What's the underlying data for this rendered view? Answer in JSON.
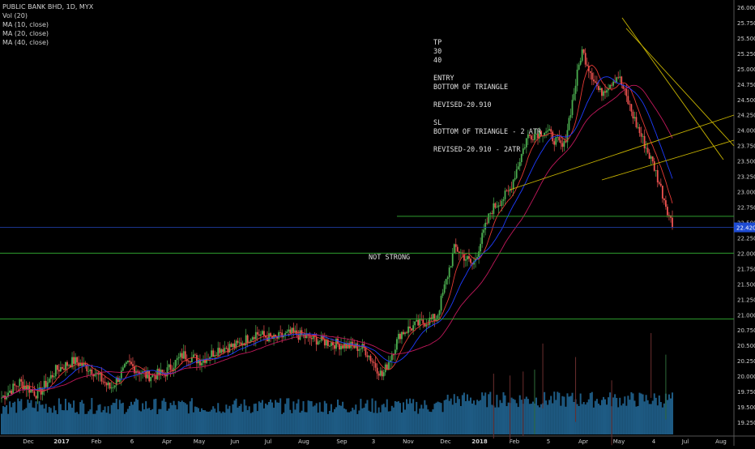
{
  "legend": {
    "symbol": "PUBLIC BANK BHD, 1D, MYX",
    "vol": "Vol (20)",
    "ma10": "MA (10, close)",
    "ma20": "MA (20, close)",
    "ma40": "MA (40, close)"
  },
  "notes": {
    "text": "TP\n30\n40\n\nENTRY\nBOTTOM OF TRIANGLE\n\nREVISED-20.910\n\nSL\nBOTTOM OF TRIANGLE - 2 ATR\n\nREVISED-20.910 - 2ATR",
    "not_strong": "NOT STRONG"
  },
  "colors": {
    "up": "#4caf50",
    "down": "#ef5350",
    "volume": "#1e5b84",
    "ma10": "#e53935",
    "ma20": "#1e3cff",
    "ma40": "#c2185b",
    "hline": "#2e9e2e",
    "trend": "#c8b400",
    "price_line": "#1e3ca0",
    "price_badge": "#1e4bd2"
  },
  "chart_data": {
    "type": "candlestick",
    "title": "PUBLIC BANK BHD, 1D, MYX",
    "ylim": [
      19.1,
      26.1
    ],
    "y_ticks": [
      "26.000",
      "25.750",
      "25.500",
      "25.250",
      "25.000",
      "24.750",
      "24.500",
      "24.250",
      "24.000",
      "23.750",
      "23.500",
      "23.250",
      "23.000",
      "22.750",
      "22.500",
      "22.250",
      "22.000",
      "21.750",
      "21.500",
      "21.250",
      "21.000",
      "20.750",
      "20.500",
      "20.250",
      "20.000",
      "19.750",
      "19.500",
      "19.250"
    ],
    "x_ticks": [
      "Dec",
      "2017",
      "Feb",
      "6",
      "Apr",
      "May",
      "Jun",
      "Jul",
      "Aug",
      "Sep",
      "3",
      "Nov",
      "Dec",
      "2018",
      "Feb",
      "5",
      "Apr",
      "May",
      "4",
      "Jul",
      "Aug"
    ],
    "last_price": "22.420",
    "horizontal_levels": [
      22.6,
      22.0,
      20.93
    ],
    "trend_lines": [
      {
        "from": [
          "May 2018",
          25.8
        ],
        "to": [
          "Jul 2018",
          23.55
        ]
      },
      {
        "from": [
          "May 2018",
          25.45
        ],
        "to": [
          "Jul 2018",
          23.85
        ]
      },
      {
        "from": [
          "Feb 2018",
          23.05
        ],
        "to": [
          "Aug 2018",
          24.27
        ]
      },
      {
        "from": [
          "May 2018",
          23.2
        ],
        "to": [
          "Aug 2018",
          23.82
        ]
      }
    ],
    "price_path": [
      [
        "Nov 2016",
        19.65
      ],
      [
        "Dec 2016",
        19.9
      ],
      [
        "2017",
        19.7
      ],
      [
        "Jan 2017",
        20.1
      ],
      [
        "Feb 2017",
        20.25
      ],
      [
        "Feb 2017",
        20.1
      ],
      [
        "Mar 2017",
        19.8
      ],
      [
        "Mar 2017",
        20.2
      ],
      [
        "Apr 2017",
        20.0
      ],
      [
        "May 2017",
        20.05
      ],
      [
        "May 2017",
        20.35
      ],
      [
        "Jun 2017",
        20.25
      ],
      [
        "Jul 2017",
        20.45
      ],
      [
        "Jul 2017",
        20.5
      ],
      [
        "Aug 2017",
        20.7
      ],
      [
        "Aug 2017",
        20.6
      ],
      [
        "Sep 2017",
        20.7
      ],
      [
        "Sep 2017",
        20.62
      ],
      [
        "Oct 2017",
        20.55
      ],
      [
        "Nov 2017",
        20.5
      ],
      [
        "Nov 2017",
        20.45
      ],
      [
        "Dec 2017",
        20.0
      ],
      [
        "Dec 2017",
        20.7
      ],
      [
        "2018",
        20.85
      ],
      [
        "Jan 2018",
        20.95
      ],
      [
        "Feb 2018",
        22.1
      ],
      [
        "Feb 2018",
        21.8
      ],
      [
        "Mar 2018",
        22.7
      ],
      [
        "Mar 2018",
        23.0
      ],
      [
        "Apr 2018",
        23.9
      ],
      [
        "Apr 2018",
        24.0
      ],
      [
        "May 2018",
        23.7
      ],
      [
        "May 2018",
        25.3
      ],
      [
        "May 2018",
        24.6
      ],
      [
        "Jun 2018",
        24.9
      ],
      [
        "Jun 2018",
        24.1
      ],
      [
        "Jun 2018",
        23.4
      ],
      [
        "Jun 2018",
        22.45
      ]
    ]
  }
}
